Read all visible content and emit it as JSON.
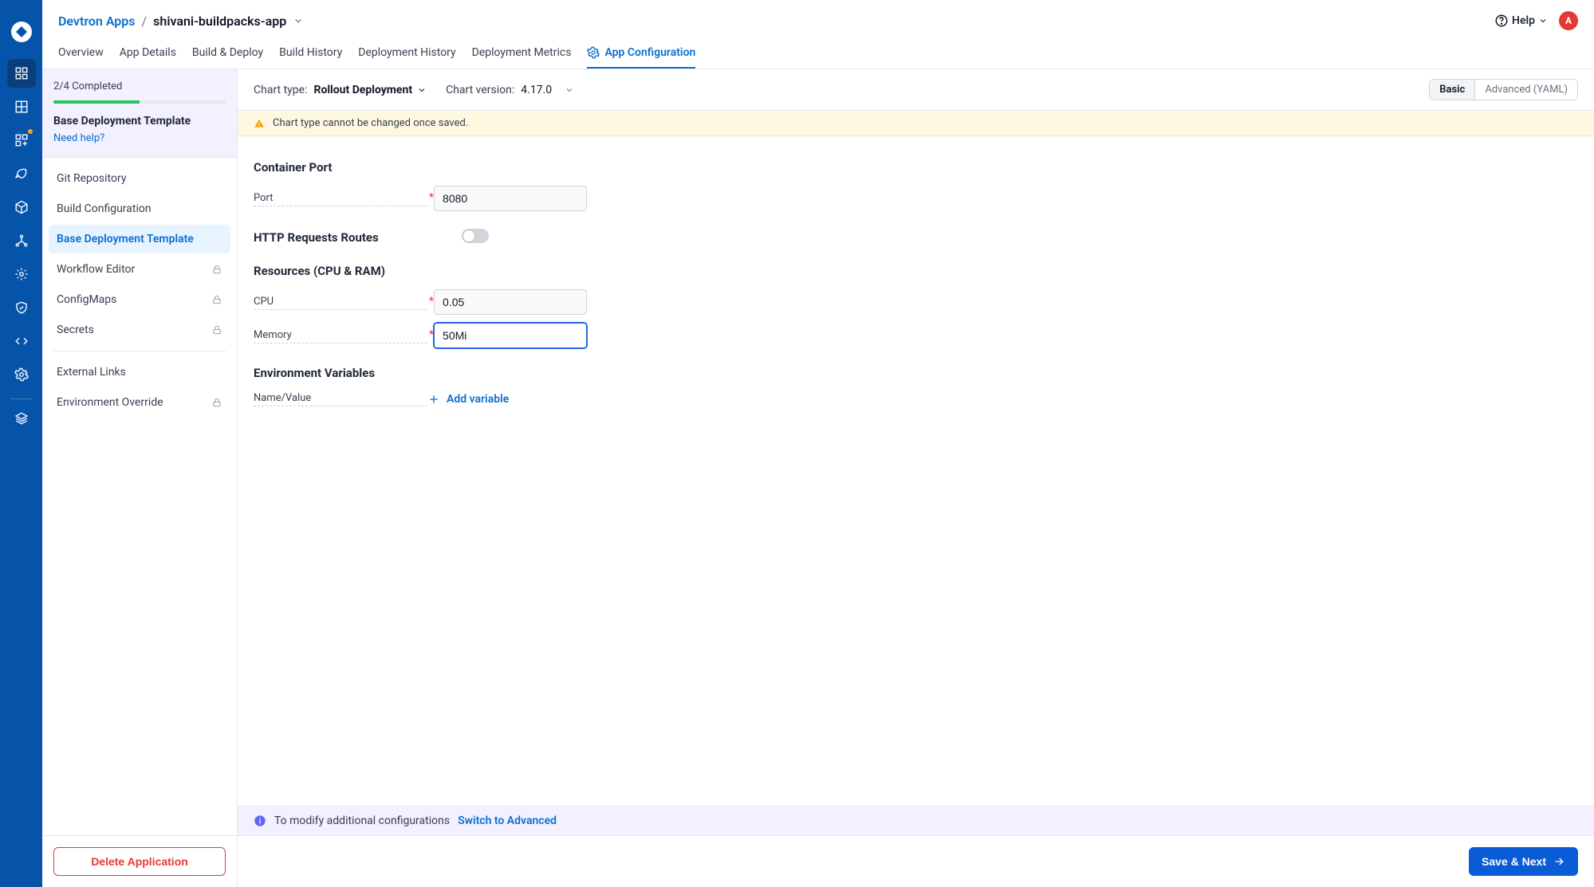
{
  "breadcrumb": {
    "root": "Devtron Apps",
    "sep": "/",
    "current": "shivani-buildpacks-app"
  },
  "header": {
    "help": "Help",
    "avatar_initial": "A"
  },
  "tabs": [
    "Overview",
    "App Details",
    "Build & Deploy",
    "Build History",
    "Deployment History",
    "Deployment Metrics",
    "App Configuration"
  ],
  "active_tab": "App Configuration",
  "status": {
    "completed_text": "2/4 Completed",
    "title": "Base Deployment Template",
    "need_help": "Need help?"
  },
  "sidebar_items": [
    {
      "label": "Git Repository",
      "locked": false,
      "active": false
    },
    {
      "label": "Build Configuration",
      "locked": false,
      "active": false
    },
    {
      "label": "Base Deployment Template",
      "locked": false,
      "active": true
    },
    {
      "label": "Workflow Editor",
      "locked": true,
      "active": false
    },
    {
      "label": "ConfigMaps",
      "locked": true,
      "active": false
    },
    {
      "label": "Secrets",
      "locked": true,
      "active": false
    }
  ],
  "sidebar_extra": [
    {
      "label": "External Links",
      "locked": false
    },
    {
      "label": "Environment Override",
      "locked": true
    }
  ],
  "delete_label": "Delete Application",
  "chart": {
    "type_label": "Chart type:",
    "type_value": "Rollout Deployment",
    "version_label": "Chart version:",
    "version_value": "4.17.0"
  },
  "segmented": {
    "basic": "Basic",
    "advanced": "Advanced (YAML)"
  },
  "warning_text": "Chart type cannot be changed once saved.",
  "sections": {
    "container_port": "Container Port",
    "http_routes": "HTTP Requests Routes",
    "resources": "Resources (CPU & RAM)",
    "env_vars": "Environment Variables"
  },
  "fields": {
    "port_label": "Port",
    "port_value": "8080",
    "cpu_label": "CPU",
    "cpu_value": "0.05",
    "memory_label": "Memory",
    "memory_value": "50Mi",
    "name_value_label": "Name/Value",
    "add_variable": "Add variable"
  },
  "info_bar": {
    "text": "To modify additional configurations",
    "link": "Switch to Advanced"
  },
  "footer": {
    "save": "Save & Next"
  }
}
